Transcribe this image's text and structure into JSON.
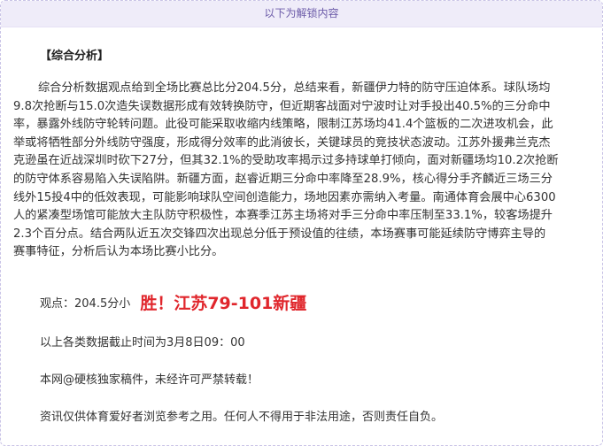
{
  "banner": {
    "text": "以下为解锁内容"
  },
  "section": {
    "heading": "【综合分析】"
  },
  "analysis": {
    "lines": [
      "综合分析数据观点给到全场比赛总比分204.5分，总结来看，新疆伊力特的防守压迫体系。球队场均",
      "9.8次抢断与15.0次造失误数据形成有效转换防守，但近期客战面对宁波时让对手投出40.5%的三分命中",
      "率，暴露外线防守轮转问题。此役可能采取收缩内线策略，限制江苏场均41.4个篮板的二次进攻机会，此",
      "举或将牺牲部分外线防守强度，形成得分效率的此消彼长，关键球员的竞技状态波动。江苏外援弗兰克杰",
      "克逊虽在近战深圳时砍下27分，但其32.1%的受助攻率揭示过多持球单打倾向，面对新疆场均10.2次抢断",
      "的防守体系容易陷入失误陷阱。新疆方面，赵睿近期三分命中率降至28.9%，核心得分手齐麟近三场三分",
      "线外15投4中的低效表现，可能影响球队空间创造能力，场地因素亦需纳入考量。南通体育会展中心6300",
      "人的紧凑型场馆可能放大主队防守积极性，本赛季江苏主场将对手三分命中率压制至33.1%，较客场提升",
      "2.3个百分点。结合两队近五次交锋四次出现总分低于预设值的往绩，本场赛事可能延续防守博弈主导的",
      "赛事特征，分析后认为本场比赛小比分。"
    ]
  },
  "viewpoint": {
    "label": "观点：204.5分小",
    "result": "胜！江苏79-101新疆",
    "result_color": "#e0262c"
  },
  "notes": {
    "cutoff": "以上各类数据截止时间为3月8日09：00",
    "copyright": "本网@硬核独家稿件，未经许可严禁转载！",
    "disclaimer": "资讯仅供体育爱好者浏览参考之用。任何人不得用于非法用途，否则责任自负。"
  }
}
